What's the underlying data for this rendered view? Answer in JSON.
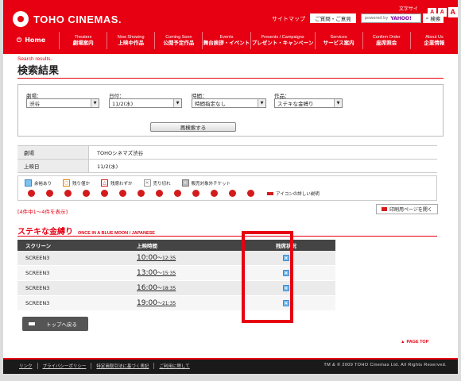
{
  "header": {
    "logo": "TOHO CINEMAS.",
    "font_size_label": "文字サイズ：",
    "font_sizes": [
      "A",
      "A",
      "A"
    ],
    "sitemap": "サイトマップ",
    "faq": "ご質問・ご意見",
    "search_placeholder": "powered by",
    "search_brand": "YAHOO!",
    "search_button": "検索"
  },
  "nav": {
    "home": "Home",
    "items": [
      {
        "en": "Theaters",
        "jp": "劇場案内"
      },
      {
        "en": "Now Showing",
        "jp": "上映中作品"
      },
      {
        "en": "Coming Soon",
        "jp": "公開予定作品"
      },
      {
        "en": "Events",
        "jp": "舞台挨拶・イベント"
      },
      {
        "en": "Presents / Campaigns",
        "jp": "プレゼント・キャンペーン"
      },
      {
        "en": "Services",
        "jp": "サービス案内"
      },
      {
        "en": "Confirm Order",
        "jp": "座席照会"
      },
      {
        "en": "About Us",
        "jp": "企業情報"
      }
    ]
  },
  "page": {
    "title_en": "Search results.",
    "title_jp": "検索結果"
  },
  "search": {
    "theater_label": "劇場：",
    "theater_value": "渋谷",
    "date_label": "日付：",
    "date_value": "11/2(水)",
    "time_label": "時間：",
    "time_value": "時間指定なし",
    "movie_label": "作品：",
    "movie_value": "ステキな金縛り",
    "research_button": "再検索する"
  },
  "info": {
    "theater_key": "劇場",
    "theater_val": "TOHOシネマズ渋谷",
    "date_key": "上映日",
    "date_val": "11/2(水)"
  },
  "legend": {
    "items": [
      {
        "icon": "available-icon",
        "label": "余裕あり"
      },
      {
        "icon": "few-left-icon",
        "label": "残り僅か"
      },
      {
        "icon": "almost-full-icon",
        "label": "残席わずか"
      },
      {
        "icon": "sold-out-icon",
        "label": "売り切れ"
      },
      {
        "icon": "no-ticket-icon",
        "label": "販売対象外チケット"
      }
    ],
    "detail_link": "アイコンの詳しい説明"
  },
  "result": {
    "count": "[4件中1～4件を表示]",
    "print_button": "印刷用ページを開く",
    "movie_title_jp": "ステキな金縛り",
    "movie_title_en": "ONCE IN A BLUE MOON / JAPANESE",
    "columns": [
      "スクリーン",
      "上映時間",
      "残席状況"
    ],
    "rows": [
      {
        "screen": "SCREEN3",
        "start": "10:00",
        "end": "～12:35"
      },
      {
        "screen": "SCREEN3",
        "start": "13:00",
        "end": "～15:35"
      },
      {
        "screen": "SCREEN3",
        "start": "16:00",
        "end": "～18:35"
      },
      {
        "screen": "SCREEN3",
        "start": "19:00",
        "end": "～21:35"
      }
    ],
    "back_button": "トップへ戻る",
    "page_top": "PAGE TOP"
  },
  "footer": {
    "links": [
      "リンク",
      "プライバシーポリシー",
      "特定商取引法に基づく表記",
      "ご利用に際して"
    ],
    "copyright": "TM & © 2009 TOHO Cinemas Ltd. All Rights Reserved."
  }
}
